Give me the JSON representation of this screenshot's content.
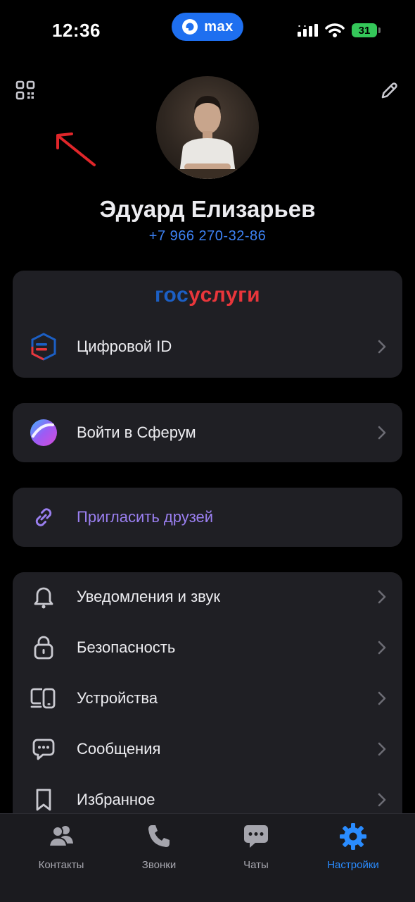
{
  "status_bar": {
    "time": "12:36",
    "app_pill": "max",
    "battery": "31"
  },
  "profile": {
    "name": "Эдуард Елизарьев",
    "phone": "+7 966 270-32-86"
  },
  "gosuslugi": {
    "logo_part1": "гос",
    "logo_part2": "услуги",
    "digital_id_label": "Цифровой ID"
  },
  "sferum": {
    "label": "Войти в Сферум"
  },
  "invite": {
    "label": "Пригласить друзей"
  },
  "settings_items": [
    {
      "label": "Уведомления и звук",
      "icon": "bell-icon"
    },
    {
      "label": "Безопасность",
      "icon": "lock-icon"
    },
    {
      "label": "Устройства",
      "icon": "devices-icon"
    },
    {
      "label": "Сообщения",
      "icon": "message-icon"
    },
    {
      "label": "Избранное",
      "icon": "bookmark-icon"
    }
  ],
  "tabs": [
    {
      "label": "Контакты",
      "icon": "contacts-icon",
      "active": false
    },
    {
      "label": "Звонки",
      "icon": "phone-icon",
      "active": false
    },
    {
      "label": "Чаты",
      "icon": "chat-icon",
      "active": false
    },
    {
      "label": "Настройки",
      "icon": "gear-icon",
      "active": true
    }
  ],
  "colors": {
    "accent": "#2a8cff",
    "invite": "#9a7ff0",
    "card_bg": "#1f1f24",
    "phone_link": "#3d82f5"
  }
}
